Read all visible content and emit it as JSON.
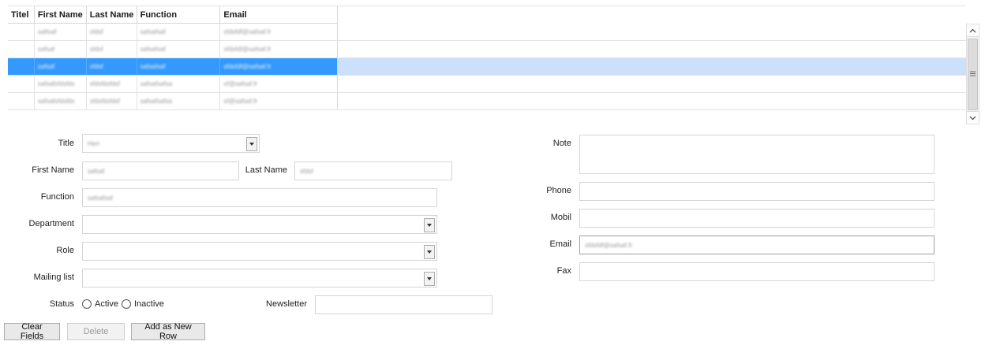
{
  "grid": {
    "columns": [
      "Titel",
      "First Name",
      "Last Name",
      "Function",
      "Email"
    ],
    "rows": [
      {
        "titel": "",
        "first": "saftsaf",
        "last": "sfdsf",
        "function": "safsafsaf",
        "email": "sfdsfdf@safsaf.fr",
        "selected": false
      },
      {
        "titel": "",
        "first": "safsaf",
        "last": "sfdsf",
        "function": "safsafsaf",
        "email": "sfdsfdf@safsaf.fr",
        "selected": false
      },
      {
        "titel": "",
        "first": "safsaf",
        "last": "sfdsf",
        "function": "safsafsaf",
        "email": "sfdsfdf@safsaf.fr",
        "selected": true
      },
      {
        "titel": "",
        "first": "safsafsfdsfds",
        "last": "sfdsfdsfdsf",
        "function": "safsafsafsa",
        "email": "sf@safsaf.fr",
        "selected": false
      },
      {
        "titel": "",
        "first": "safsafsfdsfds",
        "last": "sfdsfdsfdsf",
        "function": "safsafsafsa",
        "email": "sf@safsaf.fr",
        "selected": false
      }
    ]
  },
  "scrollbar": {
    "up_icon": "chevron-up-icon",
    "down_icon": "chevron-down-icon",
    "thumb_icon": "grip-icon"
  },
  "form": {
    "title_label": "Title",
    "title_value": "Herr",
    "first_name_label": "First Name",
    "first_name_value": "safsaf",
    "last_name_label": "Last Name",
    "last_name_value": "sfdsf",
    "function_label": "Function",
    "function_value": "safsafsaf",
    "department_label": "Department",
    "department_value": "",
    "role_label": "Role",
    "role_value": "",
    "mailing_label": "Mailing list",
    "mailing_value": "",
    "status_label": "Status",
    "status_active": "Active",
    "status_inactive": "Inactive",
    "newsletter_label": "Newsletter",
    "newsletter_value": "",
    "note_label": "Note",
    "note_value": "",
    "phone_label": "Phone",
    "phone_value": "",
    "mobil_label": "Mobil",
    "mobil_value": "",
    "email_label": "Email",
    "email_value": "sfdsfdf@safsaf.fr",
    "fax_label": "Fax",
    "fax_value": ""
  },
  "buttons": {
    "clear": "Clear Fields",
    "delete": "Delete",
    "add": "Add as New Row"
  }
}
